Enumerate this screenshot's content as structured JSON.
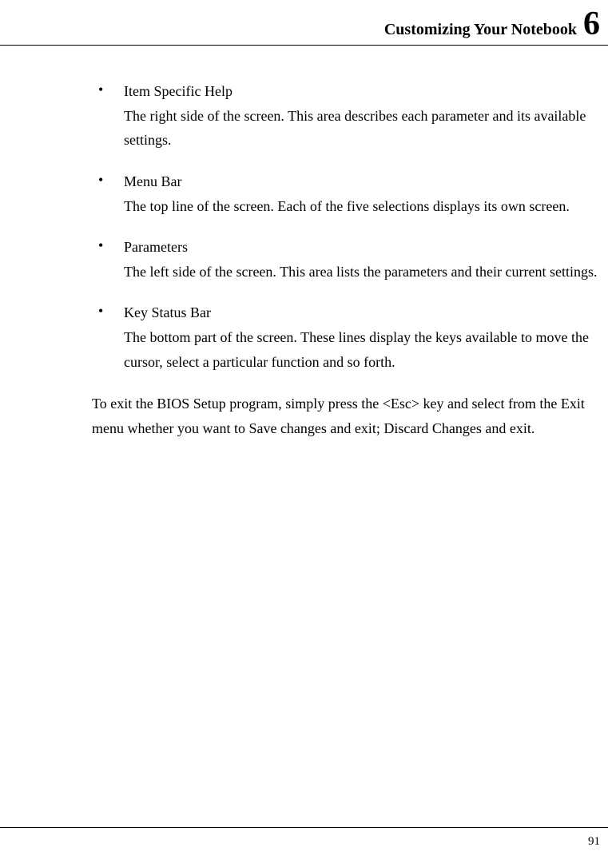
{
  "header": {
    "title": "Customizing Your Notebook",
    "chapter": "6"
  },
  "bullets": [
    {
      "title": "Item Specific Help",
      "desc": "The right side of the screen. This area describes each parameter and its available settings."
    },
    {
      "title": "Menu Bar",
      "desc": "The top line of the screen. Each of the five selections displays its own screen."
    },
    {
      "title": "Parameters",
      "desc": "The left side of the screen. This area lists the parameters and their current settings."
    },
    {
      "title": "Key Status Bar",
      "desc": "The bottom part of the screen. These lines display the keys available to move the cursor, select a particular function and so forth."
    }
  ],
  "closing": "To exit the BIOS Setup program, simply press the <Esc> key and select from the Exit menu whether you want to Save changes and exit; Discard Changes and exit.",
  "page_number": "91"
}
